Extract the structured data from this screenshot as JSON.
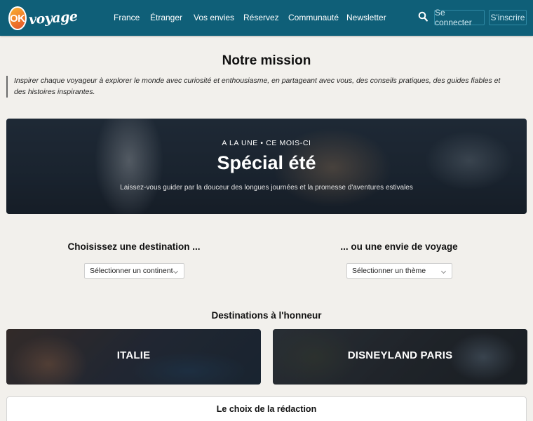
{
  "header": {
    "logo_text": "OK",
    "logo_word": "voyage",
    "nav": [
      {
        "label": "France"
      },
      {
        "label": "Étranger"
      },
      {
        "label": "Vos envies"
      },
      {
        "label": "Réservez"
      },
      {
        "label": "Communauté"
      },
      {
        "label": "Newsletter"
      }
    ],
    "search_icon": "search-icon",
    "login_label": "Se connecter",
    "signup_label": "S'inscrire",
    "colors": {
      "bar": "#0f5f78",
      "button_border": "#2f8aa6"
    }
  },
  "mission": {
    "title": "Notre mission",
    "text": "Inspirer chaque voyageur à explorer le monde avec curiosité et enthousiasme, en partageant avec vous, des conseils pratiques, des guides fiables et des histoires inspirantes."
  },
  "hero": {
    "kicker": "A LA UNE • CE MOIS-CI",
    "title": "Spécial été",
    "subtitle": "Laissez-vous guider par la douceur des longues journées et la promesse d'aventures estivales"
  },
  "selectors": {
    "destination_heading": "Choisissez une destination ...",
    "destination_select": "Sélectionner un continent",
    "envie_heading": "... ou une envie de voyage",
    "envie_select": "Sélectionner un thème"
  },
  "featured": {
    "heading": "Destinations à l'honneur",
    "cards": [
      {
        "label": "ITALIE"
      },
      {
        "label": "DISNEYLAND PARIS"
      }
    ]
  },
  "editor": {
    "title": "Le choix de la rédaction"
  }
}
